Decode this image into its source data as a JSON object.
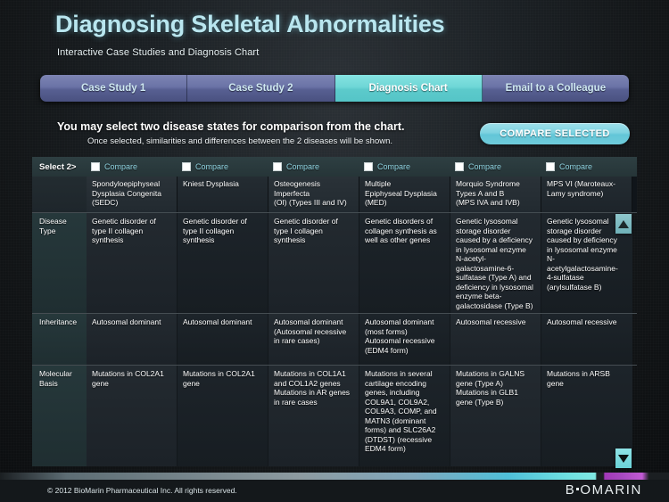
{
  "header": {
    "title": "Diagnosing Skeletal Abnormalities",
    "subtitle": "Interactive Case Studies and Diagnosis Chart"
  },
  "tabs": [
    {
      "label": "Case Study 1",
      "active": false
    },
    {
      "label": "Case Study 2",
      "active": false
    },
    {
      "label": "Diagnosis Chart",
      "active": true
    },
    {
      "label": "Email to a Colleague",
      "active": false
    }
  ],
  "instructions": {
    "main": "You may select two disease states for comparison from the chart.",
    "sub": "Once selected, similarities and differences between the 2 diseases will be shown.",
    "compare_button": "COMPARE SELECTED"
  },
  "chart": {
    "select_label": "Select 2>",
    "compare_label": "Compare",
    "columns": [
      "Spondyloepiphyseal\nDysplasia Congenita\n(SEDC)",
      "Kniest Dysplasia",
      "Osteogenesis\nImperfecta\n(OI) (Types III and IV)",
      "Multiple\nEpiphyseal Dysplasia\n(MED)",
      "Morquio Syndrome\nTypes A and B\n(MPS IVA and IVB)",
      "MPS VI (Maroteaux-\nLamy syndrome)"
    ],
    "rows": [
      {
        "label": "Disease\nType",
        "cells": [
          "Genetic disorder of\ntype II collagen\nsynthesis",
          "Genetic disorder of\ntype II collagen\nsynthesis",
          "Genetic disorder of\ntype I collagen\nsynthesis",
          "Genetic disorders of\ncollagen synthesis as\nwell as other genes",
          "Genetic lysosomal\nstorage disorder\ncaused by a deficiency\nin lysosomal enzyme\nN-acetyl-\ngalactosamine-6-\nsulfatase (Type A) and\ndeficiency in lysosomal\nenzyme beta-\ngalactosidase (Type B)",
          "Genetic lysosomal\nstorage disorder\ncaused by deficiency\nin lysosomal enzyme\nN-\nacetylgalactosamine-\n4-sulfatase\n(arylsulfatase B)"
        ]
      },
      {
        "label": "Inheritance",
        "cells": [
          "Autosomal dominant",
          "Autosomal dominant",
          "Autosomal dominant\n(Autosomal recessive\nin rare cases)",
          "Autosomal dominant\n(most forms)\nAutosomal recessive\n(EDM4 form)",
          "Autosomal recessive",
          "Autosomal recessive"
        ]
      },
      {
        "label": "Molecular\nBasis",
        "cells": [
          "Mutations in COL2A1\ngene",
          "Mutations in COL2A1\ngene",
          "Mutations in COL1A1\nand COL1A2 genes\nMutations in AR genes\nin rare cases",
          "Mutations in several\ncartilage encoding\ngenes, including\nCOL9A1, COL9A2,\nCOL9A3, COMP, and\nMATN3 (dominant\nforms) and SLC26A2\n(DTDST) (recessive\nEDM4 form)",
          "Mutations in GALNS\ngene (Type A)\nMutations in GLB1\ngene (Type B)",
          "Mutations in ARSB\ngene"
        ]
      }
    ]
  },
  "footer": {
    "copyright": "© 2012 BioMarin Pharmaceutical Inc. All rights reserved.",
    "brand_part1": "B",
    "brand_part2": "OMARIN"
  },
  "colors": {
    "accent_teal": "#6ed6d6",
    "tab_purple": "#6a73a6",
    "title_blue": "#b9e6ef",
    "row_label_bg": "#26383b"
  }
}
